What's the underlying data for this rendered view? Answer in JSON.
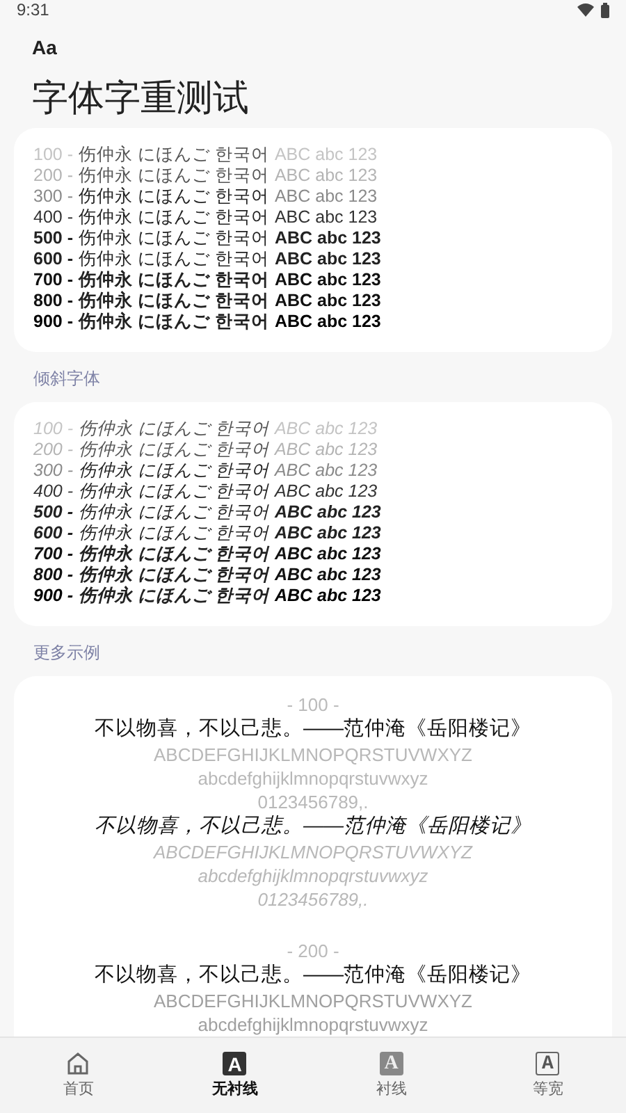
{
  "status_bar": {
    "time": "9:31"
  },
  "app_bar": {
    "logo": "Aa",
    "title": "字体字重测试"
  },
  "weights": {
    "rows": [
      {
        "label": "100 -",
        "cjk": "伤仲永 にほんご 한국어",
        "latin": "ABC abc 123"
      },
      {
        "label": "200 -",
        "cjk": "伤仲永 にほんご 한국어",
        "latin": "ABC abc 123"
      },
      {
        "label": "300 -",
        "cjk": "伤仲永 にほんご 한국어",
        "latin": "ABC abc 123"
      },
      {
        "label": "400 -",
        "cjk": "伤仲永 にほんご 한국어",
        "latin": "ABC abc 123"
      },
      {
        "label": "500 -",
        "cjk": "伤仲永 にほんご 한국어",
        "latin": "ABC abc 123"
      },
      {
        "label": "600 -",
        "cjk": "伤仲永 にほんご 한국어",
        "latin": "ABC abc 123"
      },
      {
        "label": "700 -",
        "cjk": "伤仲永 にほんご 한국어",
        "latin": "ABC abc 123"
      },
      {
        "label": "800 -",
        "cjk": "伤仲永 にほんご 한국어",
        "latin": "ABC abc 123"
      },
      {
        "label": "900 -",
        "cjk": "伤仲永 にほんご 한국어",
        "latin": "ABC abc 123"
      }
    ]
  },
  "italic": {
    "heading": "倾斜字体",
    "rows": [
      {
        "label": "100 -",
        "cjk": "伤仲永 にほんご 한국어",
        "latin": "ABC abc 123"
      },
      {
        "label": "200 -",
        "cjk": "伤仲永 にほんご 한국어",
        "latin": "ABC abc 123"
      },
      {
        "label": "300 -",
        "cjk": "伤仲永 にほんご 한국어",
        "latin": "ABC abc 123"
      },
      {
        "label": "400 -",
        "cjk": "伤仲永 にほんご 한국어",
        "latin": "ABC abc 123"
      },
      {
        "label": "500 -",
        "cjk": "伤仲永 にほんご 한국어",
        "latin": "ABC abc 123"
      },
      {
        "label": "600 -",
        "cjk": "伤仲永 にほんご 한국어",
        "latin": "ABC abc 123"
      },
      {
        "label": "700 -",
        "cjk": "伤仲永 にほんご 한국어",
        "latin": "ABC abc 123"
      },
      {
        "label": "800 -",
        "cjk": "伤仲永 にほんご 한국어",
        "latin": "ABC abc 123"
      },
      {
        "label": "900 -",
        "cjk": "伤仲永 にほんご 한국어",
        "latin": "ABC abc 123"
      }
    ]
  },
  "samples": {
    "heading": "更多示例",
    "blocks": [
      {
        "heading": "- 100 -",
        "lines": [
          {
            "kind": "cjk",
            "italic": false,
            "text": "不以物喜，不以己悲。——范仲淹《岳阳楼记》"
          },
          {
            "kind": "latin",
            "italic": false,
            "text": "ABCDEFGHIJKLMNOPQRSTUVWXYZ"
          },
          {
            "kind": "latin",
            "italic": false,
            "text": "abcdefghijklmnopqrstuvwxyz"
          },
          {
            "kind": "latin",
            "italic": false,
            "text": "0123456789,."
          },
          {
            "kind": "cjk",
            "italic": true,
            "text": "不以物喜，不以己悲。——范仲淹《岳阳楼记》"
          },
          {
            "kind": "latin",
            "italic": true,
            "text": "ABCDEFGHIJKLMNOPQRSTUVWXYZ"
          },
          {
            "kind": "latin",
            "italic": true,
            "text": "abcdefghijklmnopqrstuvwxyz"
          },
          {
            "kind": "latin",
            "italic": true,
            "text": "0123456789,."
          }
        ]
      },
      {
        "heading": "- 200 -",
        "lines": [
          {
            "kind": "cjk",
            "italic": false,
            "text": "不以物喜，不以己悲。——范仲淹《岳阳楼记》"
          },
          {
            "kind": "latin",
            "italic": false,
            "text": "ABCDEFGHIJKLMNOPQRSTUVWXYZ"
          },
          {
            "kind": "latin",
            "italic": false,
            "text": "abcdefghijklmnopqrstuvwxyz"
          }
        ]
      }
    ]
  },
  "nav": {
    "items": [
      {
        "kind": "home",
        "label": "首页",
        "selected": false
      },
      {
        "kind": "sans",
        "icon_letter": "A",
        "label": "无衬线",
        "selected": true
      },
      {
        "kind": "serif",
        "icon_letter": "A",
        "label": "衬线",
        "selected": false
      },
      {
        "kind": "mono",
        "icon_letter": "A",
        "label": "等宽",
        "selected": false
      }
    ]
  }
}
